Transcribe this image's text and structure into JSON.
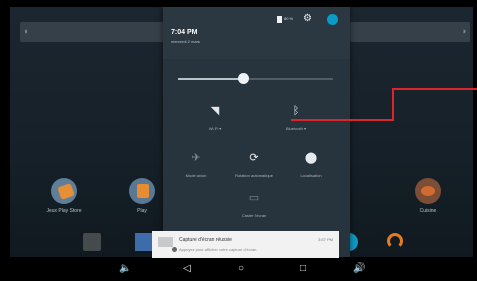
{
  "launcher": {
    "search_left": "◖",
    "search_right": "◗",
    "apps": [
      {
        "label": "Jeux Play Store"
      },
      {
        "label": "Play"
      },
      {
        "label": "Cuisine"
      }
    ]
  },
  "quick_settings": {
    "time": "7:04 PM",
    "date": "mercredi 2 mars",
    "battery": "80 %",
    "brightness_level": 0.42,
    "tiles": [
      {
        "label": "Wi-Fi ▾",
        "icon": "wifi-icon"
      },
      {
        "label": "Bluetooth ▾",
        "icon": "bluetooth-icon"
      },
      {
        "label": "Mode avion",
        "icon": "airplane-icon"
      },
      {
        "label": "Rotation automatique",
        "icon": "rotation-icon"
      },
      {
        "label": "Localisation",
        "icon": "location-icon"
      },
      {
        "label": "Caster l'écran",
        "icon": "cast-icon"
      }
    ]
  },
  "notification": {
    "title": "Capture d'écran réussie",
    "time": "3:57 PM",
    "text": "Appuyez pour afficher votre capture d'écran."
  },
  "navigation": {
    "volume_down": "🔈",
    "back": "◁",
    "home": "○",
    "recents": "□",
    "volume_up": "🔊"
  },
  "colors": {
    "accent": "#0c9bc8",
    "annotation": "#d9252b"
  }
}
